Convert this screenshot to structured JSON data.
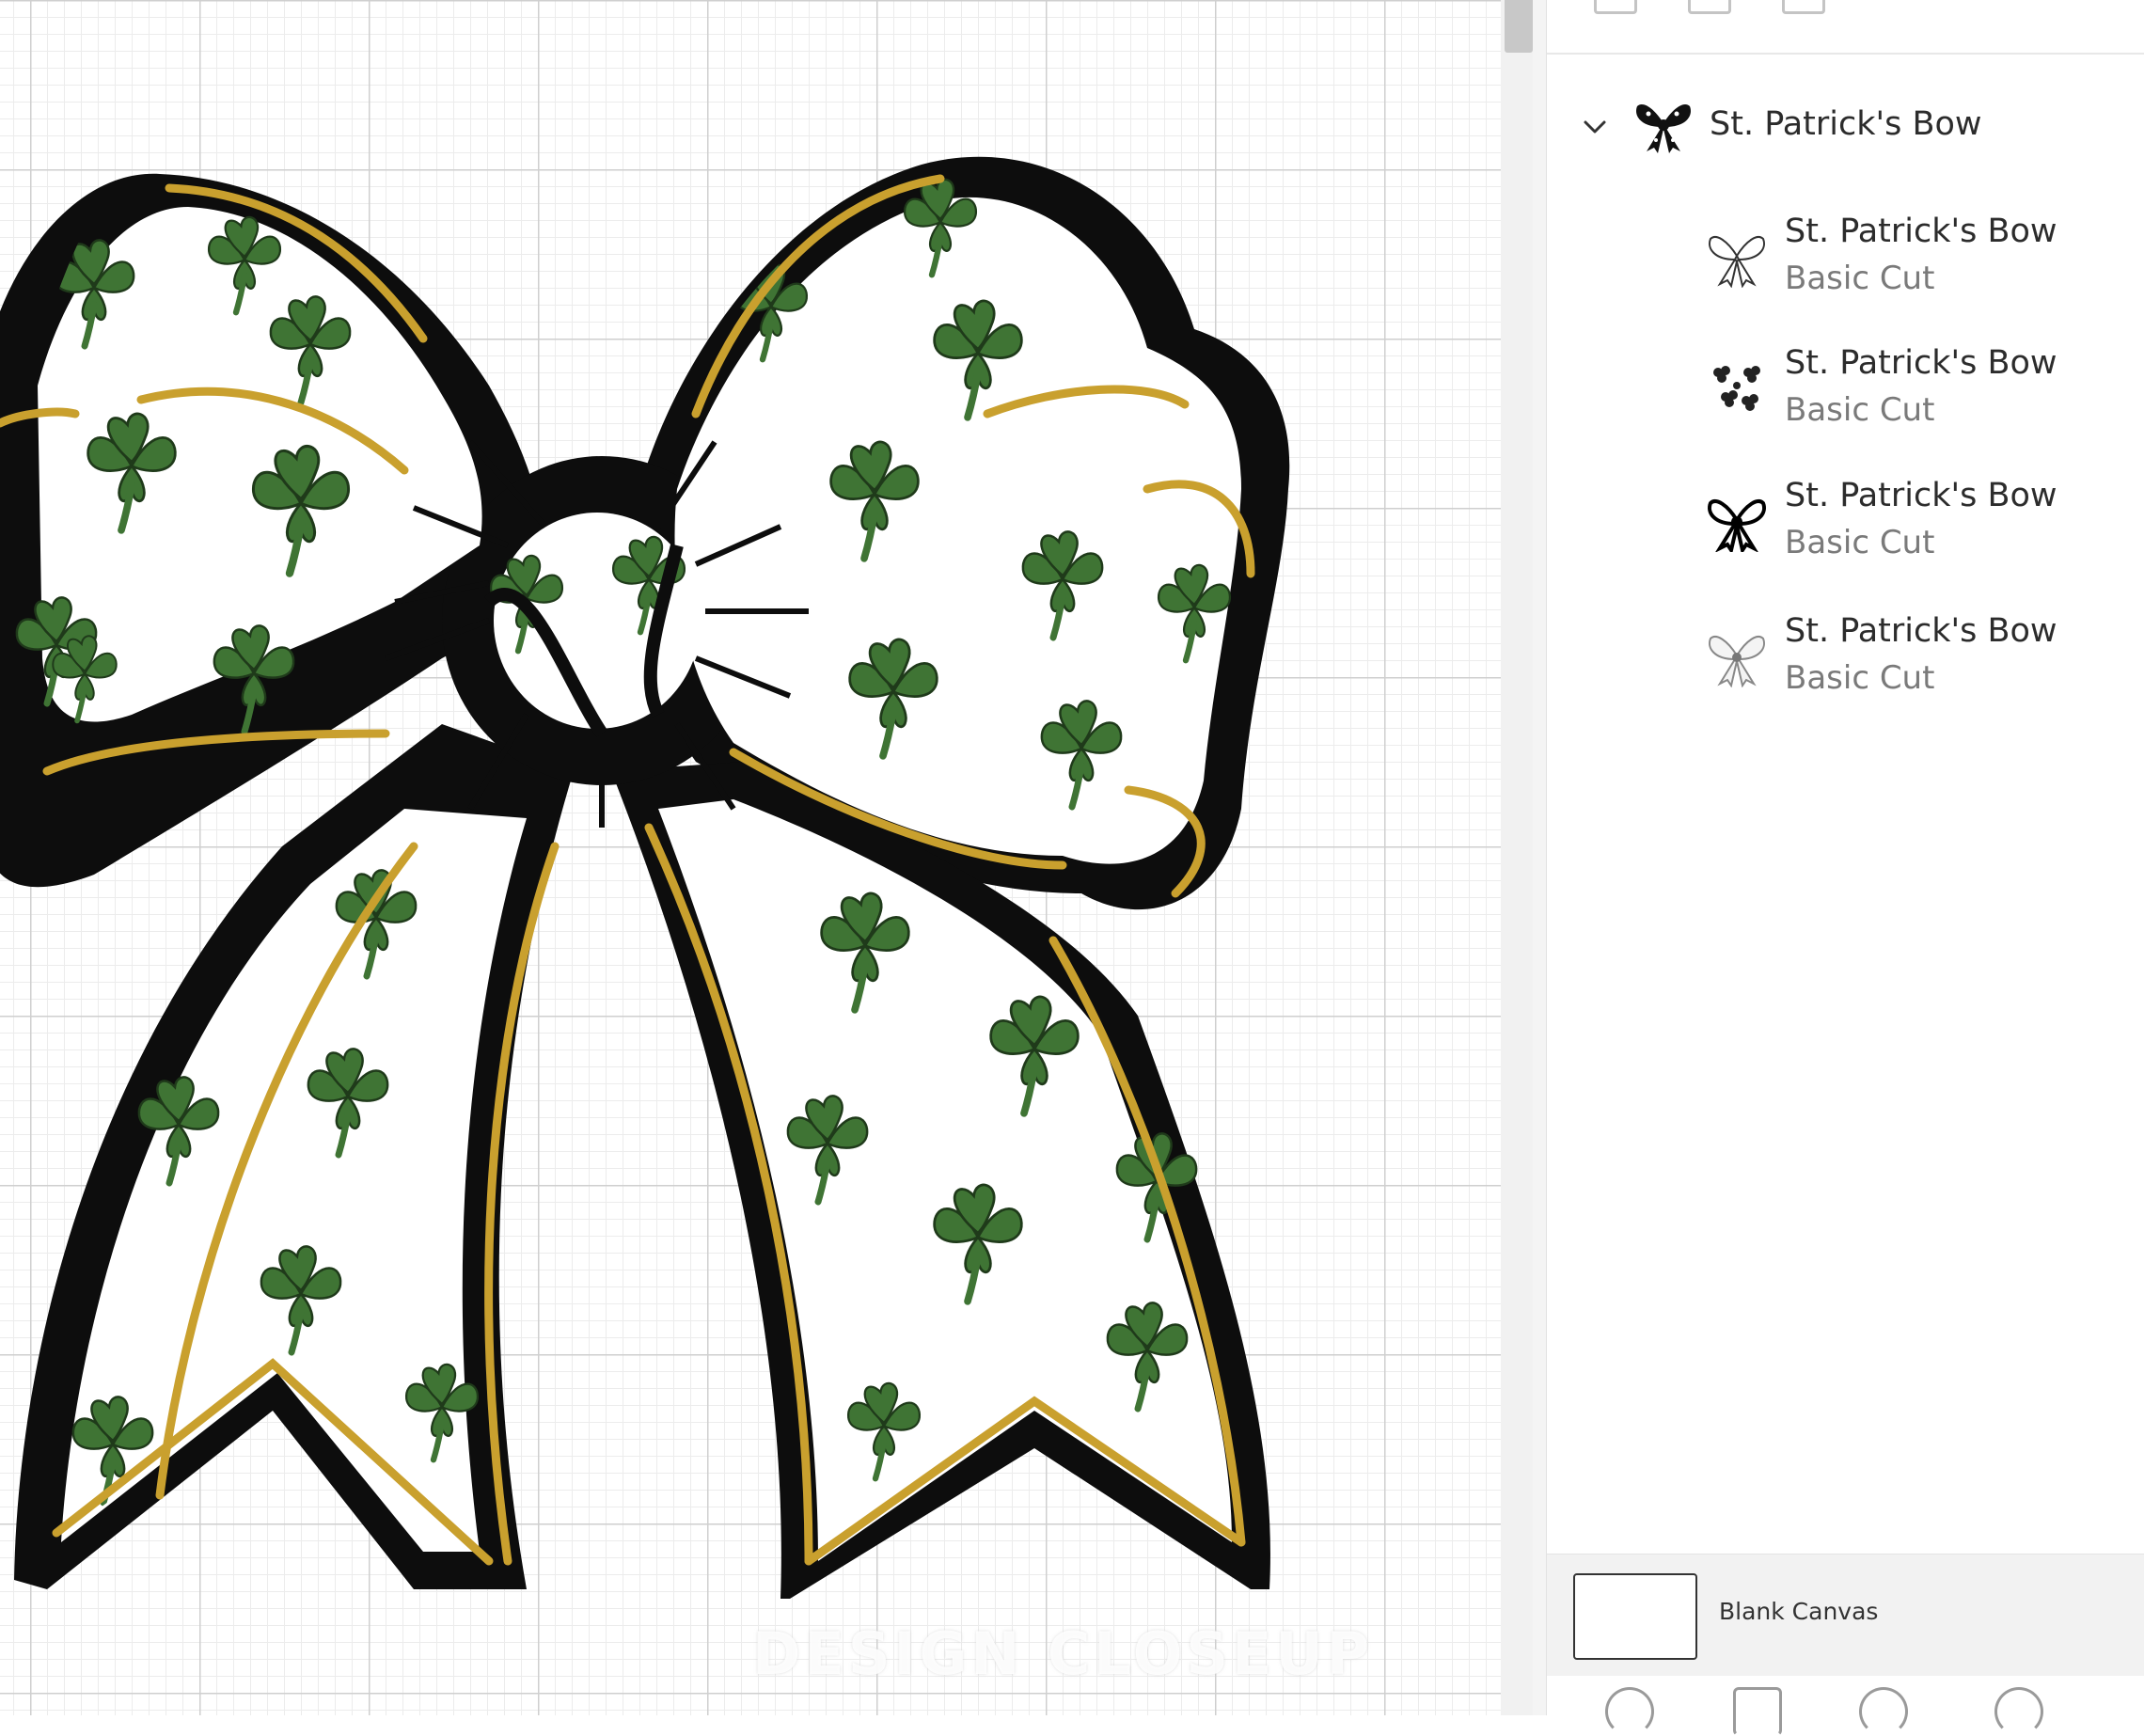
{
  "canvas": {
    "watermark_text": "DESIGN CLOSEUP"
  },
  "layers_panel": {
    "group": {
      "label": "St. Patrick's Bow",
      "expanded": true,
      "icon": "bow-thumbnail"
    },
    "layers": [
      {
        "name": "St. Patrick's Bow",
        "operation": "Basic Cut",
        "icon": "bow-outline-thumbnail"
      },
      {
        "name": "St. Patrick's Bow",
        "operation": "Basic Cut",
        "icon": "shamrock-pattern-thumbnail"
      },
      {
        "name": "St. Patrick's Bow",
        "operation": "Basic Cut",
        "icon": "bow-black-thumbnail"
      },
      {
        "name": "St. Patrick's Bow",
        "operation": "Basic Cut",
        "icon": "bow-gold-thumbnail"
      }
    ],
    "blank_canvas": {
      "label": "Blank Canvas"
    }
  },
  "colors": {
    "shamrock_green": "#3f7434",
    "ribbon_gold": "#c9a02e",
    "outline_black": "#0d0d0d",
    "panel_text": "#2c2c2c",
    "secondary_text": "#7a7a7a"
  }
}
